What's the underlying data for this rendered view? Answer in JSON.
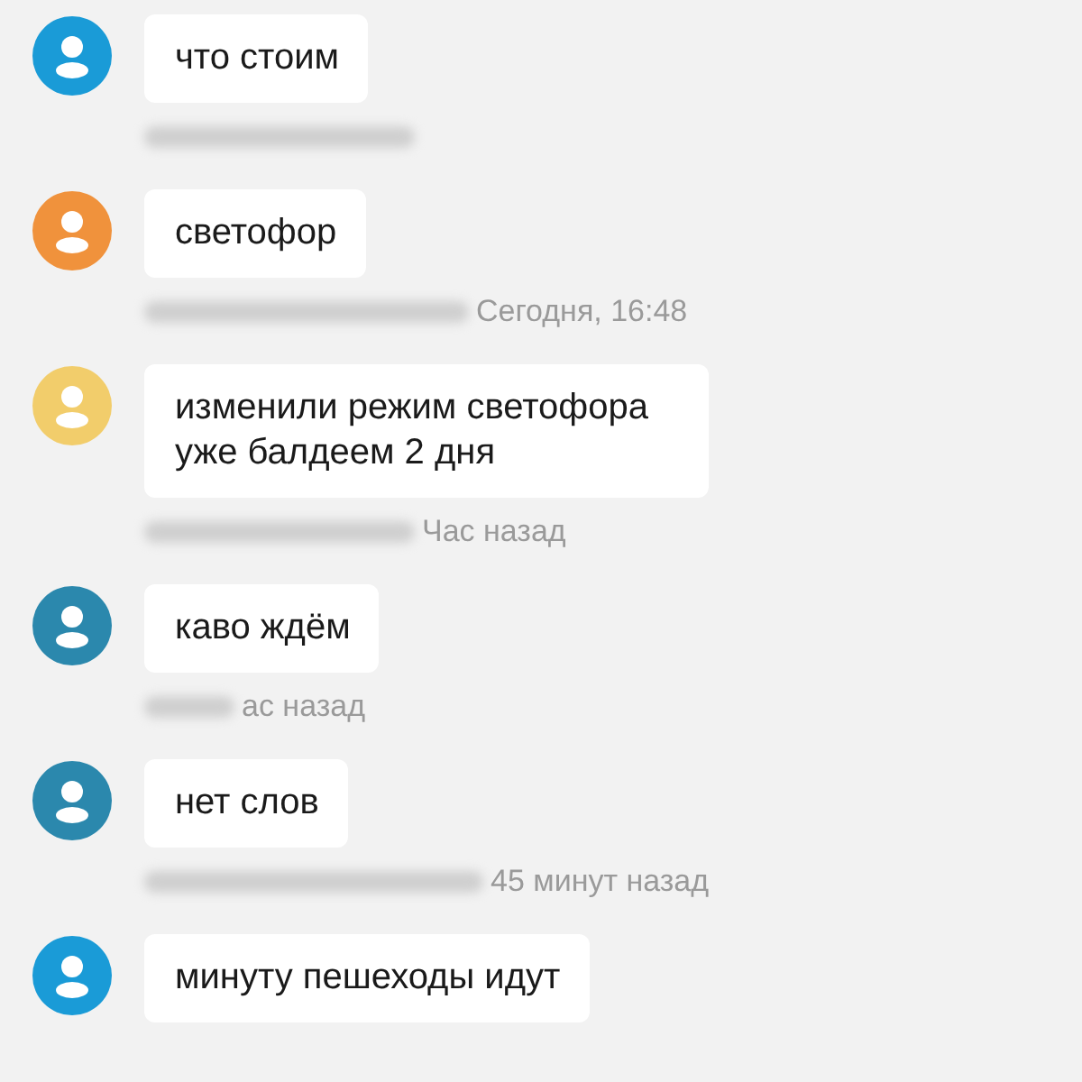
{
  "messages": [
    {
      "text": "что стоим",
      "color": "#1a9bd7",
      "author_hidden": true
    },
    {
      "text": "светофор",
      "color": "#f0923c",
      "author_hidden": true,
      "time": "Сегодня, 16:48"
    },
    {
      "text": "изменили режим светофора уже балдеем 2 дня",
      "color": "#f2cd6b",
      "author_hidden": true,
      "time": "Час назад"
    },
    {
      "text": "каво ждём",
      "color": "#2b88ad",
      "author_hidden": true,
      "time": "ас назад"
    },
    {
      "text": "нет слов",
      "color": "#2b88ad",
      "author_hidden": true,
      "time": "45 минут назад"
    },
    {
      "text": "минуту пешеходы идут",
      "color": "#1a9bd7"
    }
  ]
}
